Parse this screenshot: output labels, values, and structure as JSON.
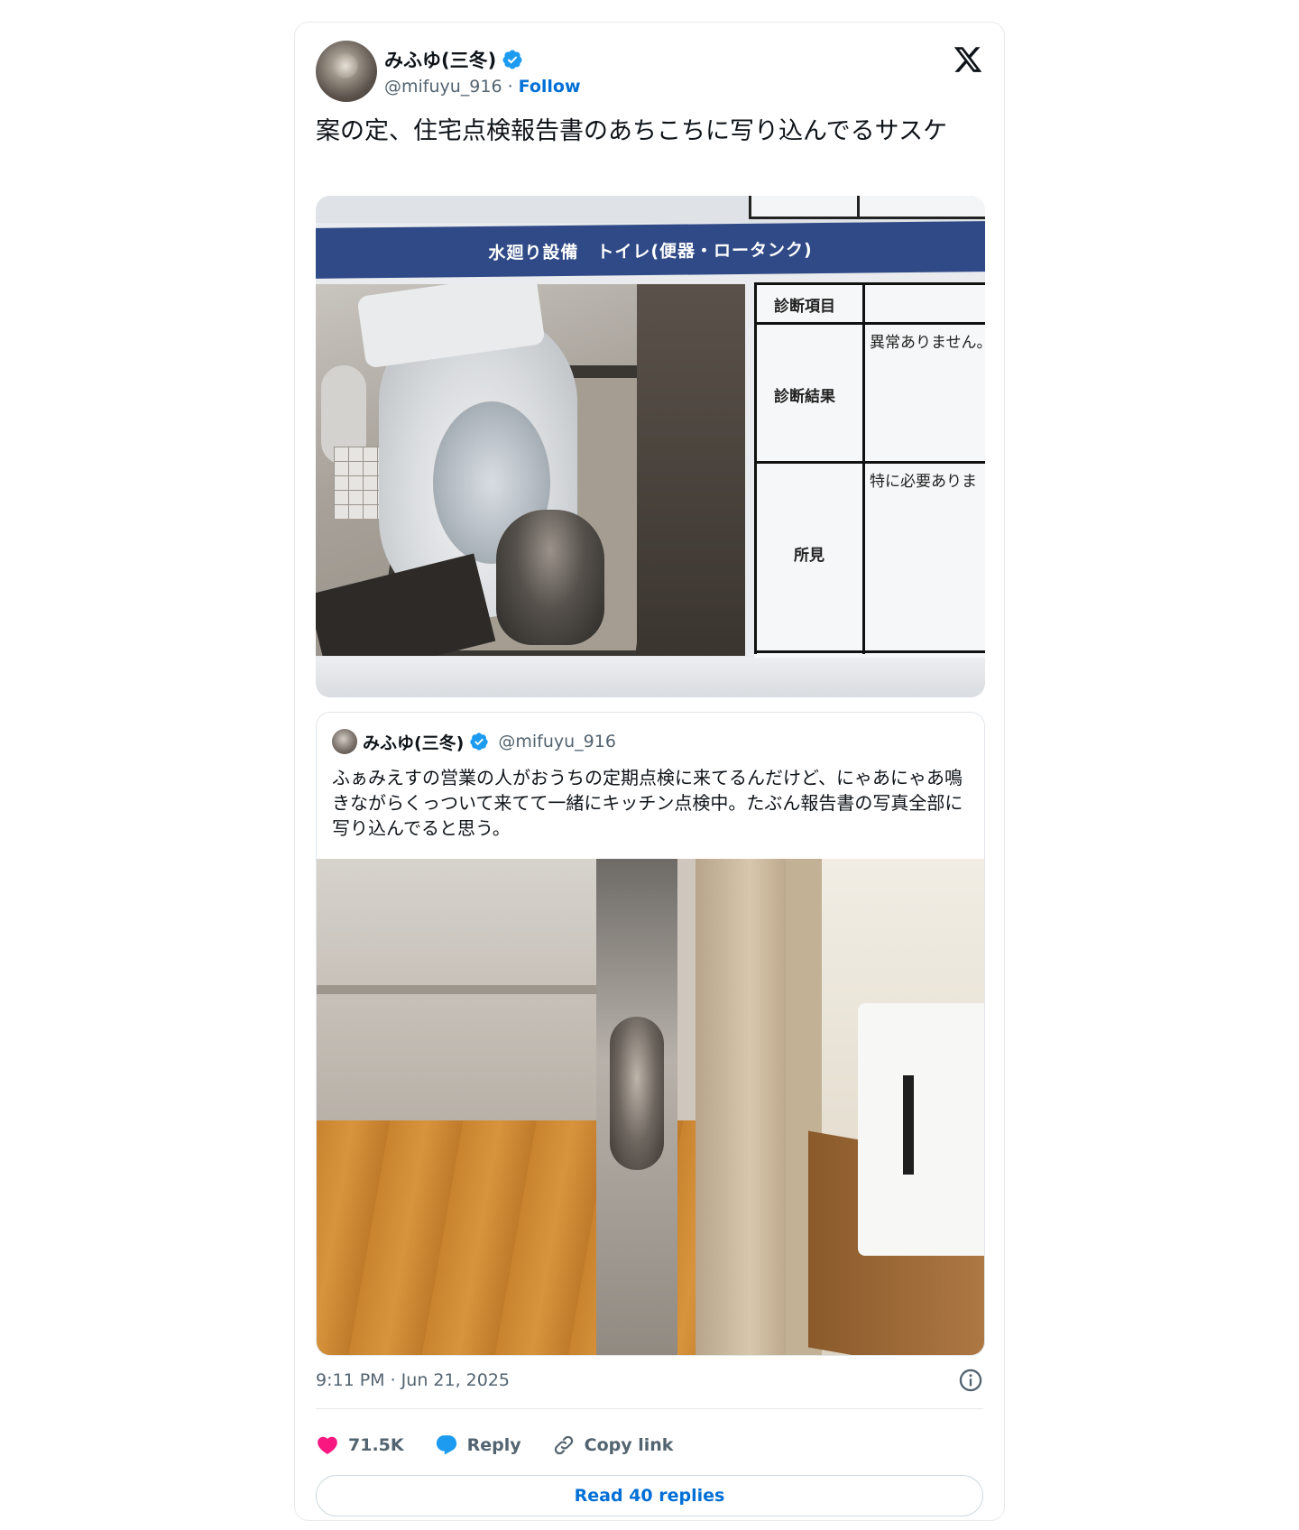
{
  "tweet": {
    "author": {
      "display_name": "みふゆ(三冬)",
      "handle": "@mifuyu_916",
      "separator": "·",
      "follow_label": "Follow",
      "verified": true
    },
    "text": "案の定、住宅点検報告書のあちこちに写り込んでるサスケ",
    "report_image": {
      "header": "水廻り設備　トイレ(便器・ロータンク)",
      "rows": [
        {
          "label": "診断項目",
          "value": ""
        },
        {
          "label": "診断結果",
          "value": "異常ありません。"
        },
        {
          "label": "所見",
          "value": "特に必要ありま"
        }
      ]
    },
    "quoted": {
      "display_name": "みふゆ(三冬)",
      "handle": "@mifuyu_916",
      "text": "ふぁみえすの営業の人がおうちの定期点検に来てるんだけど、にゃあにゃあ鳴きながらくっついて来てて一緒にキッチン点検中。たぶん報告書の写真全部に写り込んでると思う。"
    },
    "timestamp": "9:11 PM · Jun 21, 2025",
    "actions": {
      "likes": "71.5K",
      "reply_label": "Reply",
      "copy_link_label": "Copy link"
    },
    "read_replies_label": "Read 40 replies"
  },
  "colors": {
    "link_blue": "#006fd6",
    "verified_blue": "#1d9bf0",
    "heart_pink": "#f91880",
    "muted_text": "#536471",
    "report_band": "#2f4a86"
  },
  "icons": [
    "verified-badge-icon",
    "x-logo-icon",
    "info-icon",
    "heart-icon",
    "reply-bubble-icon",
    "link-icon"
  ]
}
